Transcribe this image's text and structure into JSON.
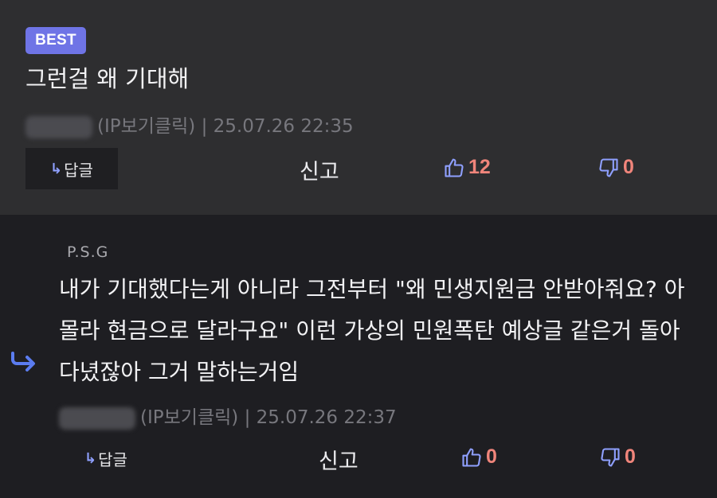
{
  "best_comment": {
    "badge": "BEST",
    "text": "그런걸 왜 기대해",
    "meta_ip": "(IP보기클릭)",
    "meta_sep": "|",
    "timestamp": "25.07.26 22:35",
    "reply_label": "답글",
    "report_label": "신고",
    "upvotes": "12",
    "downvotes": "0"
  },
  "reply_comment": {
    "author": "P.S.G",
    "text": "내가 기대했다는게 아니라 그전부터 \"왜 민생지원금 안받아줘요? 아 몰라 현금으로 달라구요\" 이런 가상의 민원폭탄 예상글 같은거 돌아다녔잖아 그거 말하는거임",
    "meta_ip": "(IP보기클릭)",
    "meta_sep": "|",
    "timestamp": "25.07.26 22:37",
    "reply_label": "답글",
    "report_label": "신고",
    "upvotes": "0",
    "downvotes": "0"
  },
  "icons": {
    "reply": "reply-arrow-icon",
    "thumbs_up": "thumbs-up-icon",
    "thumbs_down": "thumbs-down-icon",
    "reply_indicator": "reply-indicator-arrow-icon"
  },
  "colors": {
    "best_badge": "#6f74e6",
    "vote_count": "#f0857b",
    "icon_accent": "#8fa0ff",
    "best_bg": "#2e2e30",
    "reply_bg": "#1e1e22"
  }
}
